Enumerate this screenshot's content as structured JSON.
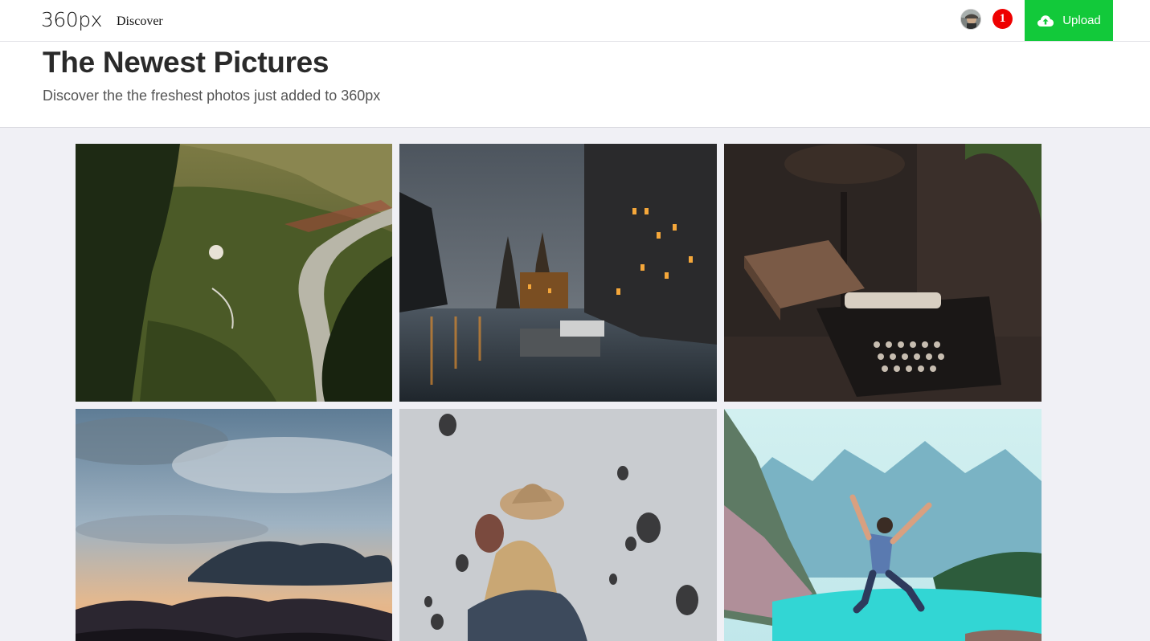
{
  "nav": {
    "logo": "360px",
    "discover_label": "Discover",
    "notification_count": "1",
    "upload_label": "Upload"
  },
  "header": {
    "title": "The Newest Pictures",
    "subtitle": "Discover the the freshest photos just added to 360px"
  },
  "photos": [
    {
      "subject": "forest-valley-river-aerial"
    },
    {
      "subject": "canal-city-night"
    },
    {
      "subject": "vintage-typewriter-desk"
    },
    {
      "subject": "sunset-clouds-mountains"
    },
    {
      "subject": "woman-hat-hot-air-balloons"
    },
    {
      "subject": "man-jumping-turquoise-lake"
    }
  ],
  "colors": {
    "upload_green": "#12c93a",
    "badge_red": "#ee0000",
    "gallery_bg": "#f0f0f5"
  }
}
